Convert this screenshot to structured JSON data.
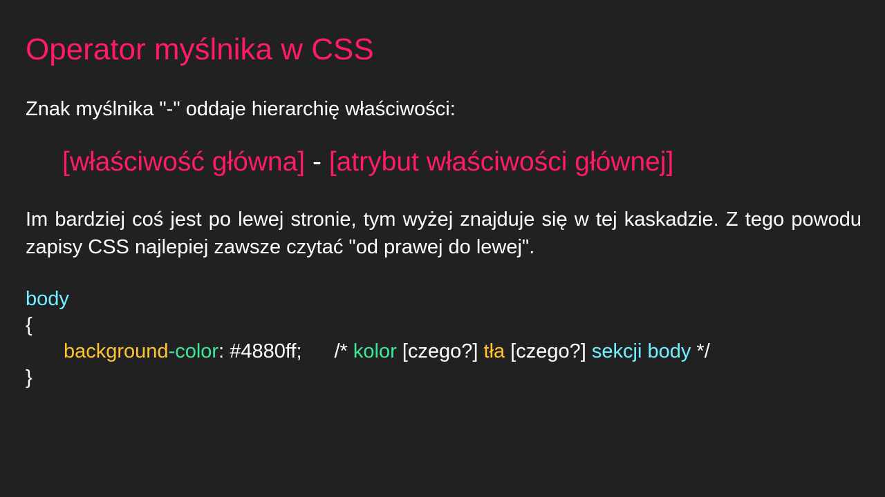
{
  "slide": {
    "title": "Operator myślnika w CSS",
    "intro": "Znak myślnika \"-\" oddaje hierarchię właściwości:",
    "formula": {
      "left": "[właściwość główna]",
      "separator": " - ",
      "right": "[atrybut właściwości głównej]"
    },
    "paragraph": "Im bardziej coś jest po lewej stronie, tym wyżej znajduje się w tej kaskadzie. Z tego powodu zapisy CSS najlepiej zawsze czytać \"od prawej do lewej\".",
    "code": {
      "selector": "body",
      "open_brace": "{",
      "property_part1": "background",
      "property_dash": "-",
      "property_part2": "color",
      "colon_value": ": #4880ff;",
      "comment_open": "/* ",
      "comment_word1": "kolor",
      "comment_q1": " [czego?] ",
      "comment_word2": "tła",
      "comment_q2": " [czego?] ",
      "comment_word3": "sekcji body",
      "comment_close": " */",
      "close_brace": "}"
    },
    "colors": {
      "background": "#212121",
      "accent_pink": "#ff1a6a",
      "code_cyan": "#6ff2ff",
      "code_yellow": "#ffc42e",
      "code_green": "#3de89a",
      "text": "#ffffff"
    }
  }
}
